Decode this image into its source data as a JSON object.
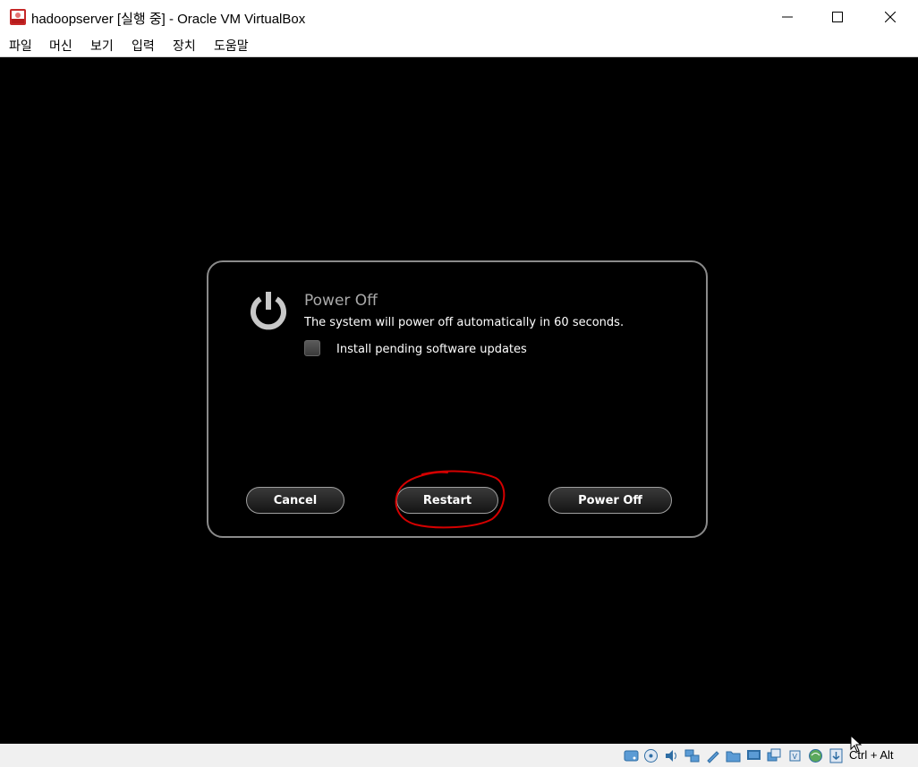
{
  "window": {
    "title": "hadoopserver [실행 중] - Oracle VM VirtualBox",
    "controls": [
      "minimize-icon",
      "maximize-icon",
      "close-icon"
    ]
  },
  "menubar": {
    "items": [
      "파일",
      "머신",
      "보기",
      "입력",
      "장치",
      "도움말"
    ]
  },
  "dialog": {
    "icon": "power-icon",
    "title": "Power Off",
    "message": "The system will power off automatically in 60 seconds.",
    "checkbox_label": "Install pending software updates",
    "checkbox_checked": false,
    "buttons": {
      "cancel": "Cancel",
      "restart": "Restart",
      "poweroff": "Power Off"
    },
    "annotation_color": "#d40000"
  },
  "statusbar": {
    "icons": [
      "hard-disk-icon",
      "optical-drive-icon",
      "audio-icon",
      "network-icon",
      "usb-icon",
      "shared-folder-icon",
      "display-icon",
      "video-capture-icon",
      "cpu-icon",
      "virtualization-icon",
      "mouse-integration-icon"
    ],
    "host_key": "Ctrl + Alt"
  },
  "colors": {
    "vm_background": "#000000",
    "dialog_border": "#8a8a8a",
    "dialog_title": "#a9a9a9"
  }
}
